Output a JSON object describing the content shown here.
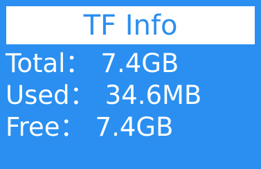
{
  "title": "TF Info",
  "rows": [
    {
      "label": "Total：",
      "value": "7.4GB"
    },
    {
      "label": "Used：",
      "value": "34.6MB"
    },
    {
      "label": "Free：",
      "value": "7.4GB"
    }
  ],
  "colors": {
    "background": "#2a8ff0",
    "title_bar": "#ffffff",
    "title_text": "#2a8ff0",
    "row_text": "#ffffff"
  }
}
